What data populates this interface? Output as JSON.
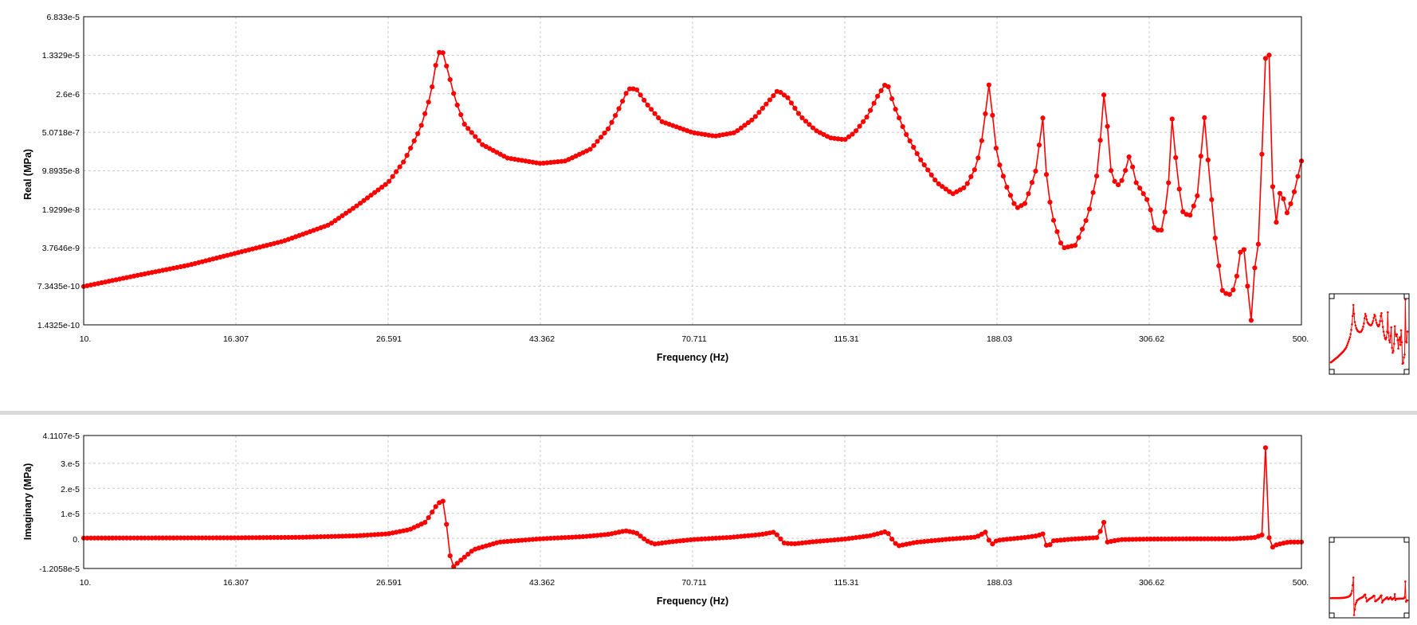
{
  "colors": {
    "series": "#ff0000",
    "grid": "#c8c8c8",
    "frame": "#000000",
    "divider": "#d9d9d9"
  },
  "chart_data": [
    {
      "type": "line",
      "name": "real",
      "xscale": "log",
      "yscale": "log",
      "xlim": [
        10,
        500
      ],
      "ylim": [
        1.4325e-10,
        6.833e-05
      ],
      "xlabel": "Frequency (Hz)",
      "ylabel": "Real (MPa)",
      "x_ticks": [
        "10.",
        "16.307",
        "26.591",
        "43.362",
        "70.711",
        "115.31",
        "188.03",
        "306.62",
        "500."
      ],
      "y_ticks": [
        "6.833e-5",
        "1.3329e-5",
        "2.6e-6",
        "5.0718e-7",
        "9.8935e-8",
        "1.9299e-8",
        "3.7646e-9",
        "7.3435e-10",
        "1.4325e-10"
      ],
      "grid": true,
      "markers": true,
      "points": [
        [
          10,
          7.3e-10
        ],
        [
          12,
          1.2e-09
        ],
        [
          14,
          1.8e-09
        ],
        [
          16.307,
          3e-09
        ],
        [
          19,
          5e-09
        ],
        [
          22,
          1e-08
        ],
        [
          24,
          2.2e-08
        ],
        [
          26.591,
          6e-08
        ],
        [
          28,
          1.5e-07
        ],
        [
          29.5,
          6e-07
        ],
        [
          30.5,
          2.5e-06
        ],
        [
          31.2,
          1.5e-05
        ],
        [
          31.7,
          1.5e-05
        ],
        [
          32.3,
          6e-06
        ],
        [
          33,
          2e-06
        ],
        [
          34,
          7e-07
        ],
        [
          36,
          3e-07
        ],
        [
          39,
          1.7e-07
        ],
        [
          43.362,
          1.35e-07
        ],
        [
          47,
          1.5e-07
        ],
        [
          51,
          2.5e-07
        ],
        [
          54,
          6e-07
        ],
        [
          56,
          1.5e-06
        ],
        [
          57.5,
          3.2e-06
        ],
        [
          59,
          3.2e-06
        ],
        [
          61,
          1.7e-06
        ],
        [
          64,
          8e-07
        ],
        [
          70.711,
          5e-07
        ],
        [
          76,
          4.3e-07
        ],
        [
          81,
          5e-07
        ],
        [
          86,
          9e-07
        ],
        [
          90,
          1.8e-06
        ],
        [
          93,
          3e-06
        ],
        [
          96,
          2.2e-06
        ],
        [
          100,
          1e-06
        ],
        [
          105,
          5.5e-07
        ],
        [
          110,
          4e-07
        ],
        [
          115.31,
          3.7e-07
        ],
        [
          119,
          5e-07
        ],
        [
          124,
          1e-06
        ],
        [
          128,
          2.3e-06
        ],
        [
          132,
          4.3e-06
        ],
        [
          135,
          1.6e-06
        ],
        [
          140,
          5e-07
        ],
        [
          147,
          1.6e-07
        ],
        [
          155,
          6e-08
        ],
        [
          163,
          3.7e-08
        ],
        [
          170,
          5e-08
        ],
        [
          176,
          1.2e-07
        ],
        [
          180,
          5e-07
        ],
        [
          183,
          4.3e-06
        ],
        [
          186,
          7e-07
        ],
        [
          188.03,
          1.8e-07
        ],
        [
          194,
          5e-08
        ],
        [
          200,
          2e-08
        ],
        [
          206,
          2.5e-08
        ],
        [
          213,
          1e-07
        ],
        [
          218,
          1e-06
        ],
        [
          220,
          1e-07
        ],
        [
          224,
          1.6e-08
        ],
        [
          232,
          3.7e-09
        ],
        [
          242,
          4.2e-09
        ],
        [
          252,
          1.5e-08
        ],
        [
          260,
          1e-07
        ],
        [
          266,
          4.5e-06
        ],
        [
          270,
          1.2e-07
        ],
        [
          276,
          5e-08
        ],
        [
          282,
          7e-08
        ],
        [
          288,
          2e-07
        ],
        [
          294,
          6e-08
        ],
        [
          300,
          4e-08
        ],
        [
          306.62,
          2.5e-08
        ],
        [
          312,
          8e-09
        ],
        [
          320,
          8e-09
        ],
        [
          326,
          5e-08
        ],
        [
          330,
          9e-07
        ],
        [
          336,
          7e-08
        ],
        [
          342,
          1.6e-08
        ],
        [
          350,
          1.5e-08
        ],
        [
          358,
          3.5e-08
        ],
        [
          366,
          1e-06
        ],
        [
          372,
          8e-08
        ],
        [
          380,
          4e-09
        ],
        [
          388,
          6e-10
        ],
        [
          396,
          5e-10
        ],
        [
          404,
          7e-10
        ],
        [
          414,
          6e-09
        ],
        [
          420,
          9e-10
        ],
        [
          425,
          1.43e-10
        ],
        [
          430,
          1.5e-09
        ],
        [
          436,
          5e-09
        ],
        [
          444,
          4e-06
        ],
        [
          448,
          6.833e-05
        ],
        [
          452,
          6e-06
        ],
        [
          456,
          4.5e-08
        ],
        [
          462,
          9e-09
        ],
        [
          468,
          6e-08
        ],
        [
          476,
          1.5e-08
        ],
        [
          486,
          3e-08
        ],
        [
          500,
          1.5e-07
        ]
      ]
    },
    {
      "type": "line",
      "name": "imaginary",
      "xscale": "log",
      "yscale": "linear",
      "xlim": [
        10,
        500
      ],
      "ylim": [
        -1.2058e-05,
        4.1107e-05
      ],
      "xlabel": "Frequency (Hz)",
      "ylabel": "Imaginary (MPa)",
      "x_ticks": [
        "10.",
        "16.307",
        "26.591",
        "43.362",
        "70.711",
        "115.31",
        "188.03",
        "306.62",
        "500."
      ],
      "y_ticks": [
        "4.1107e-5",
        "3.e-5",
        "2.e-5",
        "1.e-5",
        "0.",
        "-1.2058e-5"
      ],
      "grid": true,
      "markers": true,
      "points": [
        [
          10,
          1e-07
        ],
        [
          16.307,
          2e-07
        ],
        [
          20,
          4e-07
        ],
        [
          24,
          1e-06
        ],
        [
          26.591,
          1.8e-06
        ],
        [
          28.5,
          3.5e-06
        ],
        [
          30,
          6.5e-06
        ],
        [
          31.2,
          1.4e-05
        ],
        [
          31.8,
          1.5e-05
        ],
        [
          32.6,
          -1.2058e-05
        ],
        [
          33.5,
          -9e-06
        ],
        [
          35,
          -4.5e-06
        ],
        [
          38,
          -1.5e-06
        ],
        [
          43.362,
          -2e-07
        ],
        [
          50,
          7e-07
        ],
        [
          54,
          1.6e-06
        ],
        [
          57,
          3e-06
        ],
        [
          59,
          2.2e-06
        ],
        [
          61,
          -1e-06
        ],
        [
          62.5,
          -2.3e-06
        ],
        [
          66,
          -1.4e-06
        ],
        [
          70.711,
          -5e-07
        ],
        [
          80,
          4e-07
        ],
        [
          88,
          1.5e-06
        ],
        [
          92,
          2.5e-06
        ],
        [
          95,
          -2e-06
        ],
        [
          98,
          -2.2e-06
        ],
        [
          104,
          -1.4e-06
        ],
        [
          115.31,
          -3e-07
        ],
        [
          125,
          1e-06
        ],
        [
          132,
          2.8e-06
        ],
        [
          135,
          -1.5e-06
        ],
        [
          137,
          -3e-06
        ],
        [
          145,
          -1.6e-06
        ],
        [
          160,
          -4e-07
        ],
        [
          176,
          5e-07
        ],
        [
          182,
          2.8e-06
        ],
        [
          184,
          -3e-06
        ],
        [
          188.03,
          -8e-07
        ],
        [
          205,
          3e-07
        ],
        [
          214,
          1e-06
        ],
        [
          218,
          1.8e-06
        ],
        [
          221,
          -4e-06
        ],
        [
          225,
          -1e-06
        ],
        [
          240,
          -3e-07
        ],
        [
          260,
          3e-07
        ],
        [
          265,
          6.5e-06
        ],
        [
          268,
          -1.5e-06
        ],
        [
          280,
          -5e-07
        ],
        [
          306.62,
          -3e-07
        ],
        [
          350,
          -2e-07
        ],
        [
          400,
          -2e-07
        ],
        [
          430,
          3e-07
        ],
        [
          442,
          1.5e-06
        ],
        [
          446,
          4.1107e-05
        ],
        [
          450,
          1.5e-06
        ],
        [
          453,
          -4e-06
        ],
        [
          462,
          -2.5e-06
        ],
        [
          480,
          -1.5e-06
        ],
        [
          500,
          -1.5e-06
        ]
      ]
    }
  ]
}
